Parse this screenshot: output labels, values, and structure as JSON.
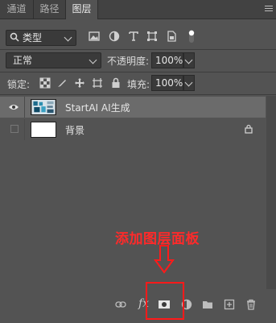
{
  "tabs": [
    {
      "label": "通道",
      "active": false
    },
    {
      "label": "路径",
      "active": false
    },
    {
      "label": "图层",
      "active": true
    }
  ],
  "filter": {
    "kind_label": "类型",
    "icons": [
      "image-filter-icon",
      "adjustment-filter-icon",
      "type-filter-icon",
      "shape-filter-icon",
      "smart-object-filter-icon",
      "filter-toggle-icon"
    ]
  },
  "blend": {
    "mode": "正常",
    "opacity_label": "不透明度:",
    "opacity_value": "100%"
  },
  "lock": {
    "label": "锁定:",
    "fill_label": "填充:",
    "fill_value": "100%"
  },
  "layers": [
    {
      "name": "StartAI AI生成",
      "visible": true,
      "selected": true,
      "locked": false
    },
    {
      "name": "背景",
      "visible": false,
      "selected": false,
      "locked": true
    }
  ],
  "annotation": {
    "text": "添加图层面板",
    "color": "#ff2a2a"
  },
  "bottom_icons": [
    "link-layers-icon",
    "fx-icon",
    "add-mask-icon",
    "adjustment-layer-icon",
    "new-group-icon",
    "new-layer-icon",
    "delete-layer-icon"
  ],
  "fx_label": "fx",
  "colors": {
    "panel": "#535353",
    "tabbar": "#424242",
    "selected_row": "#6b6b6b",
    "accent": "#ff1a1a"
  }
}
